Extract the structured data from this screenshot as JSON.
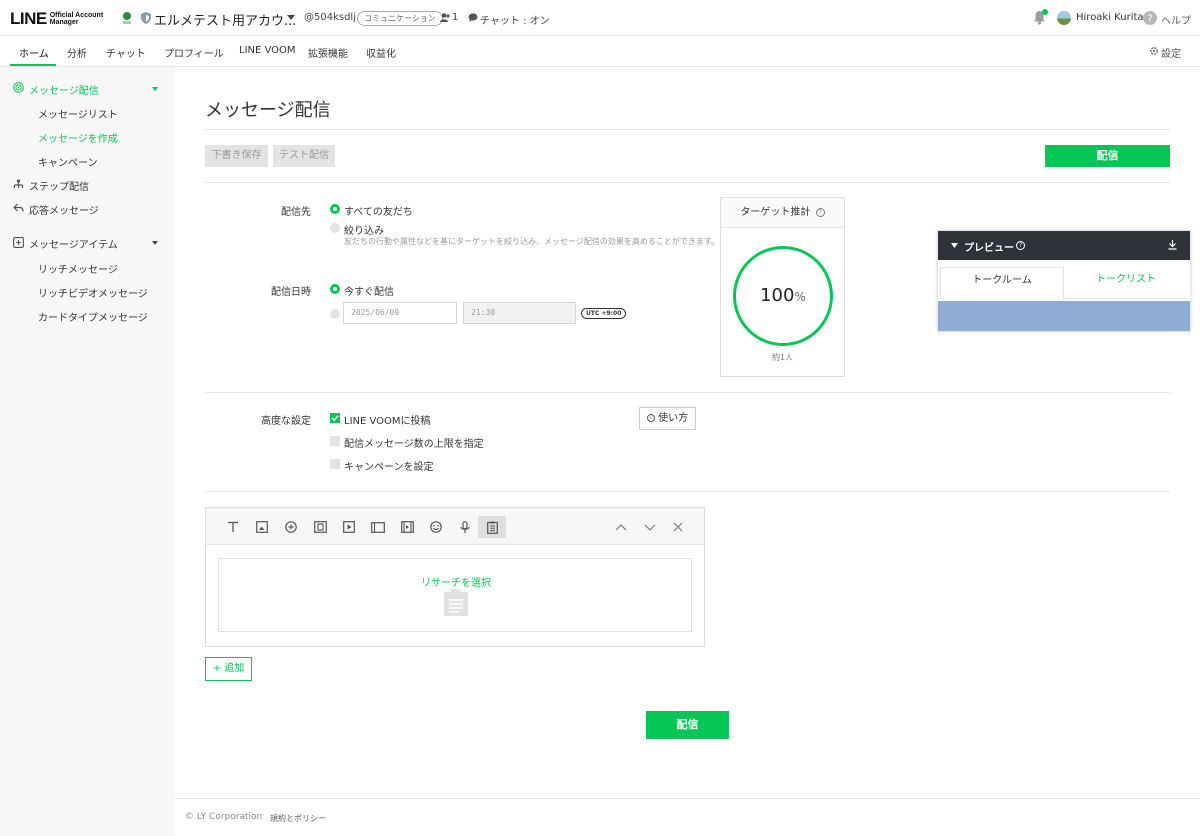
{
  "brand": {
    "logo_main": "LINE",
    "logo_sub": "Official Account Manager",
    "accent": "#06c755"
  },
  "header": {
    "account_name": "エルメテスト用アカウ...",
    "account_id": "@504ksdlj",
    "account_badge": "コミュニケーション",
    "friends_count": "1",
    "chat_status": "チャット : オン",
    "user_name": "Hiroaki Kurita",
    "help": "ヘルプ"
  },
  "nav": {
    "tabs": [
      "ホーム",
      "分析",
      "チャット",
      "プロフィール",
      "LINE VOOM",
      "拡張機能",
      "収益化"
    ],
    "active": "ホーム",
    "settings": "設定"
  },
  "sidebar": {
    "message": {
      "label": "メッセージ配信",
      "sub": [
        "メッセージリスト",
        "メッセージを作成",
        "キャンペーン"
      ],
      "active_sub": "メッセージを作成"
    },
    "step": "ステップ配信",
    "response": "応答メッセージ",
    "items": {
      "label": "メッセージアイテム",
      "sub": [
        "リッチメッセージ",
        "リッチビデオメッセージ",
        "カードタイプメッセージ"
      ]
    }
  },
  "main": {
    "title": "メッセージ配信",
    "draft_button": "下書き保存",
    "test_button": "テスト配信",
    "send_button": "配信"
  },
  "form": {
    "recipient_label": "配信先",
    "recipient_all": "すべての友だち",
    "recipient_filter": "絞り込み",
    "recipient_filter_desc": "友だちの行動や属性などを基にターゲットを絞り込み、メッセージ配信の効果を高めることができます。",
    "schedule_label": "配信日時",
    "schedule_now": "今すぐ配信",
    "schedule_date": "2025/06/09",
    "schedule_time": "21:30",
    "timezone": "UTC +9:00"
  },
  "target": {
    "title": "ターゲット推計",
    "percent": "100",
    "unit": "%",
    "count": "約1人",
    "fraction": 1.0
  },
  "preview": {
    "title": "プレビュー",
    "tab_talkroom": "トークルーム",
    "tab_talklist": "トークリスト"
  },
  "advanced": {
    "label": "高度な設定",
    "voom": "LINE VOOMに投稿",
    "voom_checked": true,
    "limit": "配信メッセージ数の上限を指定",
    "campaign": "キャンペーンを設定",
    "how_to": "使い方"
  },
  "editor": {
    "tools": [
      "text-icon",
      "image-icon",
      "stamp-icon",
      "coupon-icon",
      "video-icon",
      "card-icon",
      "rich-video-icon",
      "emoji-icon",
      "voice-icon",
      "research-icon"
    ],
    "active_tool": "research-icon",
    "select_research": "リサーチを選択",
    "add_button": "追加"
  },
  "footer": {
    "copyright": "© LY Corporation",
    "policy": "規約とポリシー"
  }
}
